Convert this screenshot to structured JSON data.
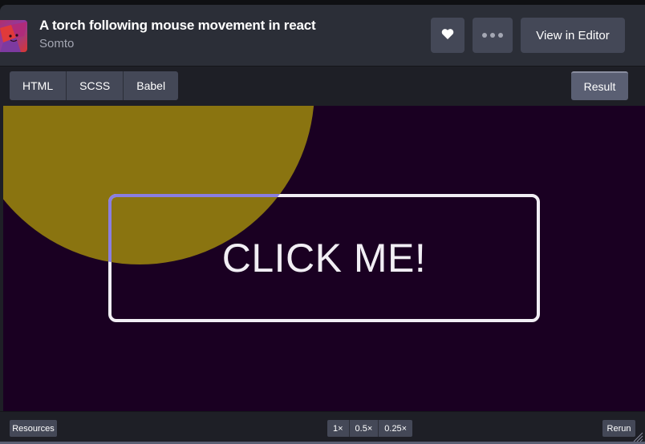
{
  "header": {
    "title": "A torch following mouse movement in react",
    "author": "Somto",
    "heart_icon": "heart-icon",
    "more_icon": "more-dots-icon",
    "editor_button": "View in Editor"
  },
  "tabs": {
    "items": [
      "HTML",
      "SCSS",
      "Babel"
    ],
    "result_label": "Result"
  },
  "preview": {
    "button_text": "CLICK ME!",
    "colors": {
      "background": "#1a0022",
      "torch": "#8a7410",
      "button_border": "#f1eef4",
      "button_border_lit": "#8a7ee0"
    }
  },
  "footer": {
    "resources": "Resources",
    "zoom_levels": [
      "1×",
      "0.5×",
      "0.25×"
    ],
    "rerun": "Rerun"
  }
}
